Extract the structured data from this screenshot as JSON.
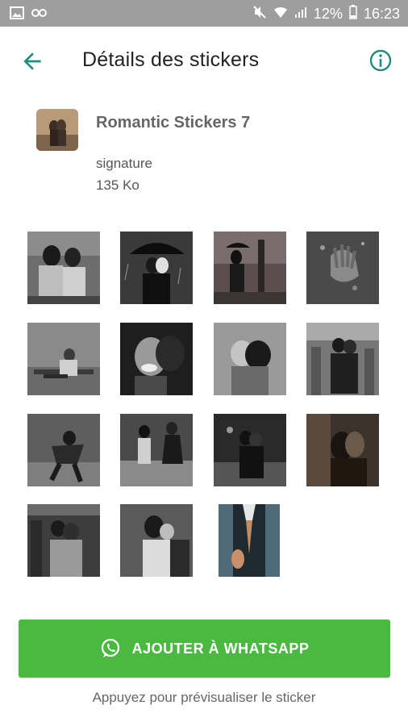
{
  "status_bar": {
    "battery_text": "12%",
    "time": "16:23",
    "icons": [
      "gallery-icon",
      "link-icon",
      "mute-icon",
      "wifi-icon",
      "signal-icon",
      "battery-icon"
    ]
  },
  "app_bar": {
    "title": "Détails des stickers",
    "back_icon": "arrow-back-icon",
    "info_icon": "info-icon"
  },
  "pack": {
    "name": "Romantic Stickers 7",
    "author": "signature",
    "size": "135 Ko"
  },
  "stickers": [
    {
      "id": 1
    },
    {
      "id": 2
    },
    {
      "id": 3
    },
    {
      "id": 4
    },
    {
      "id": 5
    },
    {
      "id": 6
    },
    {
      "id": 7
    },
    {
      "id": 8
    },
    {
      "id": 9
    },
    {
      "id": 10
    },
    {
      "id": 11
    },
    {
      "id": 12
    },
    {
      "id": 13
    },
    {
      "id": 14
    },
    {
      "id": 15
    }
  ],
  "add_button": {
    "label": "AJOUTER À WHATSAPP",
    "icon": "whatsapp-icon"
  },
  "hint": "Appuyez pour prévisualiser le sticker",
  "colors": {
    "accent": "#1e8f7e",
    "button": "#4ab940",
    "status_bar": "#9e9e9e"
  }
}
